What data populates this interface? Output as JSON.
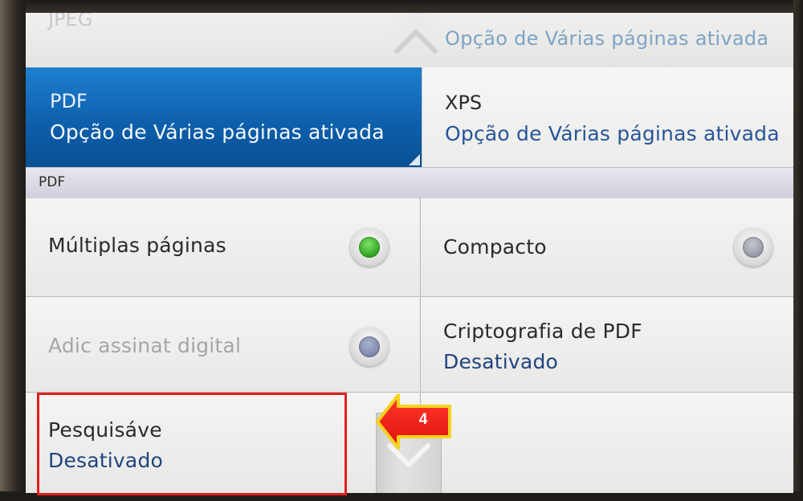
{
  "top_row": {
    "left_ghost_text": "JPEG",
    "right_value": "Opção de Várias páginas ativada"
  },
  "formats": [
    {
      "name": "PDF",
      "status": "Opção de Várias páginas ativada",
      "selected": true
    },
    {
      "name": "XPS",
      "status": "Opção de Várias páginas ativada",
      "selected": false
    }
  ],
  "section": {
    "title": "PDF"
  },
  "options": {
    "multipage": {
      "label": "Múltiplas páginas",
      "checked": true
    },
    "compact": {
      "label": "Compacto",
      "checked": false
    },
    "digital_signature": {
      "label": "Adic assinat digital",
      "enabled": false
    },
    "encryption": {
      "label": "Criptografia de PDF",
      "value": "Desativado"
    },
    "searchable": {
      "label": "Pesquisáve",
      "value": "Desativado"
    }
  },
  "annotation": {
    "step": "4",
    "highlight_color": "#e11f1f",
    "arrow_color": "#ff2020"
  },
  "colors": {
    "selected_tile": "#0d5eaa",
    "value_text": "#21447f",
    "radio_on": "#2fa21c"
  },
  "icons": {
    "scroll_up": "chevron-up-icon",
    "scroll_down": "chevron-down-icon"
  }
}
